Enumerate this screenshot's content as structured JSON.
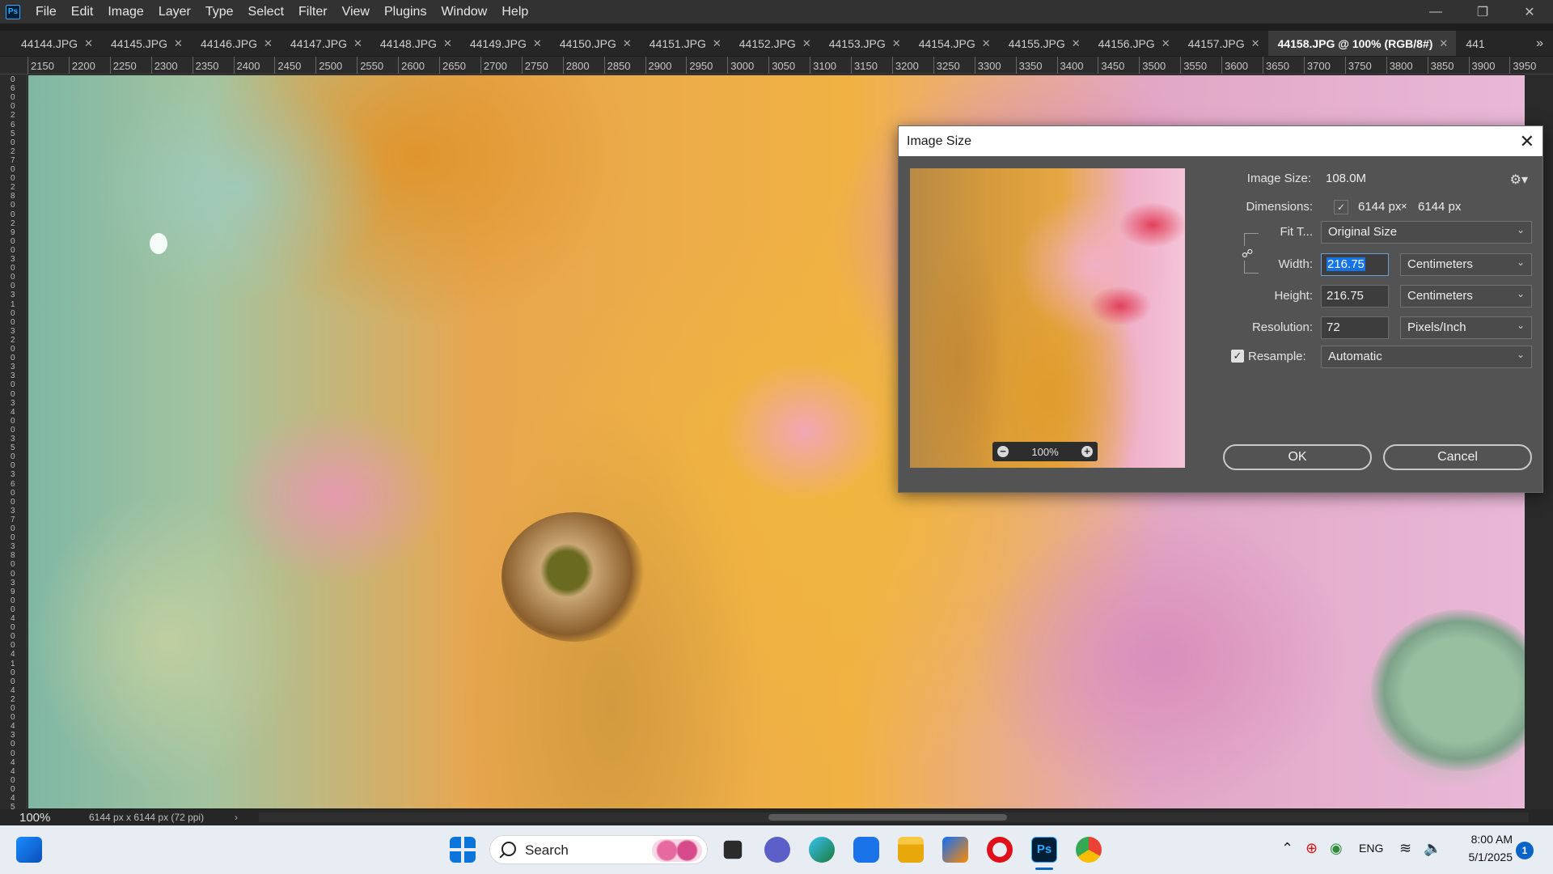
{
  "app": {
    "logo": "Ps"
  },
  "menu": [
    "File",
    "Edit",
    "Image",
    "Layer",
    "Type",
    "Select",
    "Filter",
    "View",
    "Plugins",
    "Window",
    "Help"
  ],
  "tabs": [
    {
      "label": "44144.JPG",
      "active": false
    },
    {
      "label": "44145.JPG",
      "active": false
    },
    {
      "label": "44146.JPG",
      "active": false
    },
    {
      "label": "44147.JPG",
      "active": false
    },
    {
      "label": "44148.JPG",
      "active": false
    },
    {
      "label": "44149.JPG",
      "active": false
    },
    {
      "label": "44150.JPG",
      "active": false
    },
    {
      "label": "44151.JPG",
      "active": false
    },
    {
      "label": "44152.JPG",
      "active": false
    },
    {
      "label": "44153.JPG",
      "active": false
    },
    {
      "label": "44154.JPG",
      "active": false
    },
    {
      "label": "44155.JPG",
      "active": false
    },
    {
      "label": "44156.JPG",
      "active": false
    },
    {
      "label": "44157.JPG",
      "active": false
    },
    {
      "label": "44158.JPG @ 100% (RGB/8#)",
      "active": true
    },
    {
      "label": "441",
      "active": false
    }
  ],
  "tab_more": "»",
  "ruler_h": [
    "2150",
    "2200",
    "2250",
    "2300",
    "2350",
    "2400",
    "2450",
    "2500",
    "2550",
    "2600",
    "2650",
    "2700",
    "2750",
    "2800",
    "2850",
    "2900",
    "2950",
    "3000",
    "3050",
    "3100",
    "3150",
    "3200",
    "3250",
    "3300",
    "3350",
    "3400",
    "3450",
    "3500",
    "3550",
    "3600",
    "3650",
    "3700",
    "3750",
    "3800",
    "3850",
    "3900",
    "3950"
  ],
  "ruler_v": [
    "0",
    "6",
    "0",
    "0",
    "2",
    "6",
    "5",
    "0",
    "2",
    "7",
    "0",
    "0",
    "2",
    "8",
    "0",
    "0",
    "2",
    "9",
    "0",
    "0",
    "3",
    "0",
    "0",
    "0",
    "3",
    "1",
    "0",
    "0",
    "3",
    "2",
    "0",
    "0",
    "3",
    "3",
    "0",
    "0",
    "3",
    "4",
    "0",
    "0",
    "3",
    "5",
    "0",
    "0",
    "3",
    "6",
    "0",
    "0",
    "3",
    "7",
    "0",
    "0",
    "3",
    "8",
    "0",
    "0",
    "3",
    "9",
    "0",
    "0",
    "4",
    "0",
    "0",
    "0",
    "4",
    "1",
    "0",
    "0",
    "4",
    "2",
    "0",
    "0",
    "4",
    "3",
    "0",
    "0",
    "4",
    "4",
    "0",
    "0",
    "4",
    "5"
  ],
  "status": {
    "zoom": "100%",
    "doc_info": "6144 px x 6144 px (72 ppi)",
    "arrow": "›"
  },
  "dialog": {
    "title": "Image Size",
    "close": "✕",
    "preview_zoom": "100%",
    "image_size_label": "Image Size:",
    "image_size_value": "108.0M",
    "dimensions_label": "Dimensions:",
    "dimensions_w": "6144 px",
    "dimensions_x": "×",
    "dimensions_h": "6144 px",
    "fit_label": "Fit T...",
    "fit_value": "Original Size",
    "width_label": "Width:",
    "width_value": "216.75",
    "width_unit": "Centimeters",
    "height_label": "Height:",
    "height_value": "216.75",
    "height_unit": "Centimeters",
    "resolution_label": "Resolution:",
    "resolution_value": "72",
    "resolution_unit": "Pixels/Inch",
    "resample_label": "Resample:",
    "resample_checked": true,
    "resample_value": "Automatic",
    "ok": "OK",
    "cancel": "Cancel"
  },
  "taskbar": {
    "search": "Search",
    "lang": "ENG",
    "time": "8:00 AM",
    "date": "5/1/2025",
    "notifications": "1"
  }
}
